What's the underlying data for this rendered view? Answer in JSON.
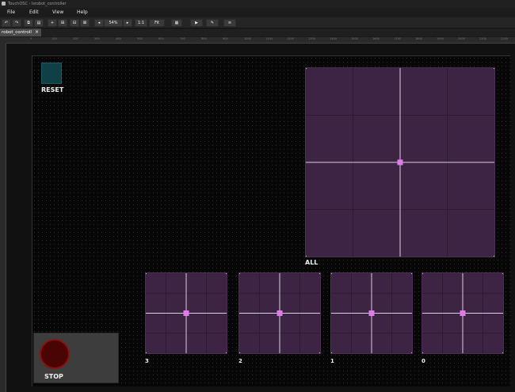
{
  "window": {
    "title": "TouchOSC - lsrobot_controller"
  },
  "menu": {
    "file": "File",
    "edit": "Edit",
    "view": "View",
    "help": "Help"
  },
  "toolbar": {
    "zoom": "54%",
    "one_to_one": "1:1",
    "fit": "Fit"
  },
  "tabs": [
    {
      "label": "robot_controll"
    }
  ],
  "ruler": {
    "ticks": [
      "0",
      "100",
      "200",
      "300",
      "400",
      "500",
      "600",
      "700",
      "800",
      "900",
      "1000",
      "1100",
      "1200",
      "1300",
      "1400",
      "1500",
      "1600",
      "1700",
      "1800",
      "1900",
      "2000",
      "2100",
      "2200"
    ]
  },
  "controls": {
    "reset": {
      "label": "RESET",
      "color": "#103f46"
    },
    "stop": {
      "label": "STOP",
      "color": "#4b0404"
    },
    "xy_pads": [
      {
        "label": "ALL"
      },
      {
        "label": "3"
      },
      {
        "label": "2"
      },
      {
        "label": "1"
      },
      {
        "label": "0"
      }
    ],
    "pad_color": "#3e2444",
    "handle_color": "#e07ae8"
  }
}
